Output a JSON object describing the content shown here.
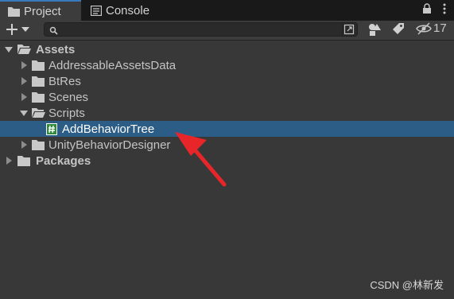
{
  "tabs": [
    {
      "label": "Project",
      "icon": "folder-icon",
      "active": true
    },
    {
      "label": "Console",
      "icon": "console-icon",
      "active": false
    }
  ],
  "toolbar": {
    "add_label": "+",
    "search_value": "",
    "hidden_count": "17"
  },
  "tree": [
    {
      "label": "Assets",
      "depth": 0,
      "expanded": true,
      "type": "folder",
      "bold": true
    },
    {
      "label": "AddressableAssetsData",
      "depth": 1,
      "expanded": false,
      "type": "folder"
    },
    {
      "label": "BtRes",
      "depth": 1,
      "expanded": false,
      "type": "folder"
    },
    {
      "label": "Scenes",
      "depth": 1,
      "expanded": false,
      "type": "folder",
      "leaf": true
    },
    {
      "label": "Scripts",
      "depth": 1,
      "expanded": true,
      "type": "folder"
    },
    {
      "label": "AddBehaviorTree",
      "depth": 2,
      "type": "script",
      "selected": true
    },
    {
      "label": "UnityBehaviorDesigner",
      "depth": 1,
      "expanded": false,
      "type": "folder"
    },
    {
      "label": "Packages",
      "depth": 0,
      "expanded": false,
      "type": "folder",
      "bold": true
    }
  ],
  "watermark": "CSDN @林新发",
  "colors": {
    "selection": "#2c5d87",
    "annotation_arrow": "#e8262a",
    "script_icon": "#2e8b3c"
  }
}
